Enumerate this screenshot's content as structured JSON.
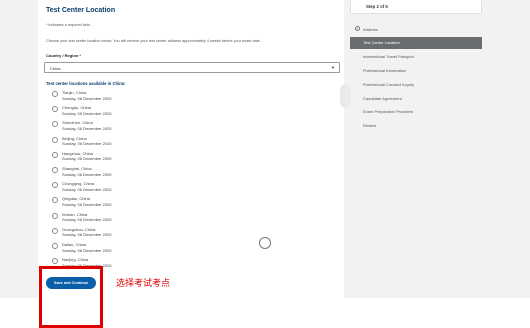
{
  "form": {
    "title": "Test Center Location",
    "required_note": "* indicates a required field.",
    "instructions": "Choose your test center location below. You will receive your test center address approximately 4 weeks before your exam date.",
    "country_label": "Country / Region *",
    "country_value": "China",
    "locations_heading": "Test center locations available in China:",
    "locations": [
      {
        "city": "Tianjin, China",
        "date": "Sunday, 06 December 2020"
      },
      {
        "city": "Chengdu, China",
        "date": "Sunday, 06 December 2020"
      },
      {
        "city": "Shenzhen, China",
        "date": "Sunday, 06 December 2020"
      },
      {
        "city": "Beijing, China",
        "date": "Sunday, 06 December 2020"
      },
      {
        "city": "Hangzhou, China",
        "date": "Sunday, 06 December 2020"
      },
      {
        "city": "Shanghai, China",
        "date": "Sunday, 06 December 2020"
      },
      {
        "city": "Chongqing, China",
        "date": "Sunday, 06 December 2020"
      },
      {
        "city": "Qingdao, China",
        "date": "Sunday, 06 December 2020"
      },
      {
        "city": "Wuhan, China",
        "date": "Sunday, 06 December 2020"
      },
      {
        "city": "Guangzhou, China",
        "date": "Sunday, 06 December 2020"
      },
      {
        "city": "Dalian, China",
        "date": "Sunday, 06 December 2020"
      },
      {
        "city": "Nanjing, China",
        "date": "Sunday, 06 December 2020"
      }
    ],
    "save_label": "Save and Continue"
  },
  "sidebar": {
    "step_text": "Step 2 of 5",
    "items": [
      {
        "label": "Address",
        "completed": true,
        "active": false
      },
      {
        "label": "Test Center Location",
        "completed": false,
        "active": true
      },
      {
        "label": "International Travel Passport",
        "completed": false,
        "active": false
      },
      {
        "label": "Professional Information",
        "completed": false,
        "active": false
      },
      {
        "label": "Professional Conduct Inquiry",
        "completed": false,
        "active": false
      },
      {
        "label": "Candidate Agreement",
        "completed": false,
        "active": false
      },
      {
        "label": "Exam Preparation Providers",
        "completed": false,
        "active": false
      },
      {
        "label": "Review",
        "completed": false,
        "active": false
      }
    ]
  },
  "annotation": {
    "text": "选择考试考点",
    "color": "#e00000"
  },
  "colors": {
    "primary": "#0a5fa8",
    "heading": "#0a3e6e",
    "nav_active": "#6a6d70"
  }
}
